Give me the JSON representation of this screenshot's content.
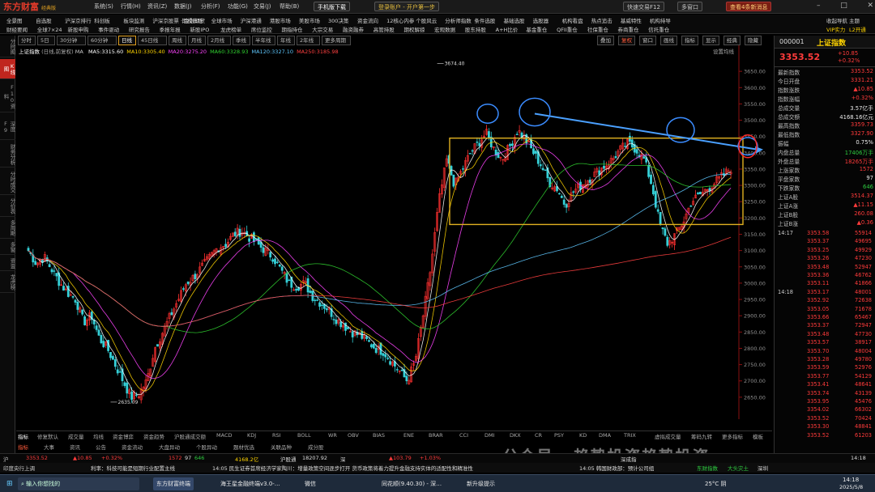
{
  "app": {
    "logo": "东方财富",
    "edition": "经典版",
    "menus": [
      "系统(S)",
      "行情(H)",
      "资讯(Z)",
      "数据(J)",
      "分析(F)",
      "功能(G)",
      "交易(J)",
      "帮助(B)"
    ],
    "phone_btn": "手机版下载",
    "login_btn": "登录账户 - 开户第一步",
    "search_btn": "快速交易F12",
    "multi_win": "多窗口",
    "notice_btn": "查看4条新消息",
    "window_controls": [
      "–",
      "□",
      "✕"
    ]
  },
  "quick_rows": {
    "row1": [
      "全景图",
      "自选股",
      "沪深京排行",
      "科创板",
      "板块监测",
      "沪深京股票 · 金融期货",
      "期权市场",
      "全球市场",
      "沪深港通",
      "港股市场",
      "美股市场",
      "300决策",
      "资金流向",
      "12核心内参",
      "个股风云",
      "分析师指数",
      "条件选股",
      "基础选股",
      "选股器",
      "机构看盘",
      "热点追击",
      "基威特性",
      "机构持导"
    ],
    "row2": [
      "财经要闻",
      "全球7×24",
      "新股申购",
      "事件驱动",
      "研究报告",
      "季报年报",
      "新股IPO",
      "龙虎榜单",
      "席位监控",
      "期指持仓",
      "大宗交易",
      "融资融券",
      "高管持股",
      "期权解掠",
      "宏观数据",
      "股东持股",
      "A+H比价",
      "基金重仓",
      "QFII重仓",
      "社保重仓",
      "券商重仓",
      "信托重仓"
    ],
    "right1": [
      "收起导航",
      "主题"
    ],
    "right2": [
      "VIP实力",
      "L2开通"
    ]
  },
  "period_bar": {
    "items": [
      "分时",
      "5日",
      "30分钟",
      "60分钟",
      "日线",
      "45日线",
      "周线",
      "月线",
      "2月线",
      "季线",
      "半年线",
      "年线",
      "2年线",
      "更多周期"
    ],
    "active": "日线",
    "right_items": [
      "叠加",
      "复权",
      "窗口",
      "画线",
      "指标",
      "显示",
      "经典",
      "隐藏"
    ]
  },
  "left_nav": [
    "分时图",
    "K线图",
    "F10资料",
    "深度F9",
    "财务分析",
    "分时成交",
    "分价表",
    "多周期",
    "多窗",
    "资金",
    "龙虎榜"
  ],
  "left_nav_active": "K线图",
  "chart": {
    "title": "上证指数",
    "subtitle": "(日线,前复权)",
    "ma_label": "MA",
    "ma": [
      {
        "name": "MA5",
        "value": "3315.60",
        "color": "#ffffff"
      },
      {
        "name": "MA10",
        "value": "3305.40",
        "color": "#ffd400"
      },
      {
        "name": "MA20",
        "value": "3275.20",
        "color": "#ff44ff"
      },
      {
        "name": "MA60",
        "value": "3328.93",
        "color": "#30d030"
      },
      {
        "name": "MA120",
        "value": "3327.10",
        "color": "#5fc8ff"
      },
      {
        "name": "MA250",
        "value": "3185.98",
        "color": "#ff4040"
      }
    ],
    "settings_label": "设置均线",
    "high_label": "3674.40",
    "low_label": "2635.09",
    "price_axis": [
      "3650.00",
      "3600.00",
      "3550.00",
      "3500.00",
      "3450.00",
      "3400.00",
      "3350.00",
      "3300.00",
      "3250.00",
      "3200.00",
      "3150.00",
      "3100.00",
      "3050.00",
      "3000.00",
      "2950.00",
      "2900.00",
      "2850.00",
      "2800.00",
      "2750.00",
      "2700.00",
      "2650.00"
    ],
    "price_range": [
      2600,
      3700
    ],
    "box_range": [
      3180,
      3445
    ],
    "trend_from": 3520,
    "trend_to": 3410
  },
  "chart_data": {
    "type": "candlestick",
    "title": "上证指数",
    "series_close_sketch": [
      3100,
      3060,
      3080,
      3040,
      3000,
      2970,
      2950,
      2880,
      2900,
      2830,
      2800,
      2750,
      2700,
      2650,
      2660,
      2700,
      2800,
      2850,
      2900,
      2950,
      3000,
      3020,
      3050,
      3080,
      3110,
      3120,
      3150,
      3160,
      3140,
      3120,
      3100,
      3080,
      3040,
      3000,
      2990,
      3000,
      2960,
      2940,
      2920,
      2890,
      2870,
      2850,
      2840,
      2820,
      2800,
      2790,
      2760,
      2730,
      2700,
      2760,
      2900,
      3050,
      3250,
      3380,
      3300,
      3350,
      3400,
      3430,
      3460,
      3410,
      3380,
      3420,
      3470,
      3440,
      3400,
      3360,
      3310,
      3290,
      3240,
      3280,
      3300,
      3320,
      3340,
      3360,
      3380,
      3410,
      3430,
      3410,
      3380,
      3300,
      3180,
      3120,
      3150,
      3190,
      3250,
      3270,
      3290,
      3310,
      3330,
      3353
    ]
  },
  "indicator_tabs": [
    "指标",
    "修复默认",
    "成交量",
    "均线",
    "资金博弈",
    "资金趋势",
    "沪股通成交额",
    "MACD",
    "KDJ",
    "RSI",
    "BOLL",
    "WR",
    "OBV",
    "BIAS",
    "ENE",
    "BRAR",
    "CCI",
    "DMI",
    "DKX",
    "CR",
    "PSY",
    "KD",
    "DMA",
    "TRIX",
    "虚拟成交量",
    "筹码九转",
    "更多指标",
    "模板"
  ],
  "bottom_tabs": [
    "指标",
    "大事",
    "资讯",
    "公告",
    "资金流动",
    "大盘异动",
    "个股异动",
    "题材优选",
    "关联品种",
    "成分股"
  ],
  "ticker": {
    "label": "沪",
    "price": "3353.52",
    "change": "▲10.85",
    "pct": "+0.32%",
    "up": "1572",
    "flat": "97",
    "down": "646",
    "amount": "4168.2亿",
    "sh_label": "沪股通",
    "shv": "18207.92",
    "sz_label": "深",
    "szc": "▲103.79",
    "szp": "+1.03%",
    "cy": "深成指",
    "time": "14:18"
  },
  "news": {
    "left": "印度央行上调",
    "items": [
      "利率：科技可能是短期行业配置主线",
      "14:05 民生证券首席经济学家陶川：增量政策空间逐步打开 货币政策将着力提升金融支持实体的适配性和精准性",
      "14:05 韩国财政部：预计公司组"
    ],
    "right": [
      "东财指数",
      "大头灾土",
      "深圳"
    ]
  },
  "right_panel": {
    "code": "000001",
    "name": "上证指数",
    "price": "3353.52",
    "change": "+10.85",
    "pct": "+0.32%",
    "fields": [
      {
        "k": "最新指数",
        "v": "3353.52",
        "c": "red"
      },
      {
        "k": "今日开盘",
        "v": "3331.21",
        "c": "red"
      },
      {
        "k": "指数涨跌",
        "v": "▲10.85",
        "c": "red"
      },
      {
        "k": "指数涨幅",
        "v": "+0.32%",
        "c": "red"
      },
      {
        "k": "总成交量",
        "v": "3.57亿手",
        "c": "white"
      },
      {
        "k": "总成交额",
        "v": "4168.16亿元",
        "c": "white"
      },
      {
        "k": "最高指数",
        "v": "3359.73",
        "c": "red"
      },
      {
        "k": "最低指数",
        "v": "3327.90",
        "c": "red"
      },
      {
        "k": "振幅",
        "v": "0.75%",
        "c": "white"
      },
      {
        "k": "内盘总量",
        "v": "17406万手",
        "c": "grn"
      },
      {
        "k": "外盘总量",
        "v": "18265万手",
        "c": "red"
      },
      {
        "k": "上涨家数",
        "v": "1572",
        "c": "red"
      },
      {
        "k": "平盘家数",
        "v": "97",
        "c": "white"
      },
      {
        "k": "下跌家数",
        "v": "646",
        "c": "grn"
      },
      {
        "k": "上证A股",
        "v": "3514.37",
        "c": "red"
      },
      {
        "k": "上证A涨",
        "v": "▲11.15",
        "c": "red"
      },
      {
        "k": "上证B股",
        "v": "260.08",
        "c": "red"
      },
      {
        "k": "上证B涨",
        "v": "▲0.36",
        "c": "red"
      }
    ],
    "ticks": [
      {
        "t": "14:17",
        "p": "3353.58",
        "v": "55914"
      },
      {
        "t": "",
        "p": "3353.37",
        "v": "49695"
      },
      {
        "t": "",
        "p": "3353.25",
        "v": "49929"
      },
      {
        "t": "",
        "p": "3353.26",
        "v": "47230"
      },
      {
        "t": "",
        "p": "3353.48",
        "v": "52947"
      },
      {
        "t": "",
        "p": "3353.36",
        "v": "46762"
      },
      {
        "t": "",
        "p": "3353.11",
        "v": "41866"
      },
      {
        "t": "14:18",
        "p": "3353.17",
        "v": "48001"
      },
      {
        "t": "",
        "p": "3352.92",
        "v": "72638"
      },
      {
        "t": "",
        "p": "3353.05",
        "v": "71678"
      },
      {
        "t": "",
        "p": "3353.66",
        "v": "65467"
      },
      {
        "t": "",
        "p": "3353.37",
        "v": "72947"
      },
      {
        "t": "",
        "p": "3353.48",
        "v": "47730"
      },
      {
        "t": "",
        "p": "3353.57",
        "v": "38917"
      },
      {
        "t": "",
        "p": "3353.70",
        "v": "48004"
      },
      {
        "t": "",
        "p": "3353.28",
        "v": "49780"
      },
      {
        "t": "",
        "p": "3353.59",
        "v": "52976"
      },
      {
        "t": "",
        "p": "3353.77",
        "v": "54129"
      },
      {
        "t": "",
        "p": "3353.41",
        "v": "48641"
      },
      {
        "t": "",
        "p": "3353.74",
        "v": "43139"
      },
      {
        "t": "",
        "p": "3353.95",
        "v": "45476"
      },
      {
        "t": "",
        "p": "3354.02",
        "v": "66302"
      },
      {
        "t": "",
        "p": "3353.52",
        "v": "70424"
      },
      {
        "t": "",
        "p": "3353.30",
        "v": "48841"
      },
      {
        "t": "",
        "p": "3353.52",
        "v": "61203"
      }
    ]
  },
  "watermark": "公众号 · 趋势投资趋势投资",
  "taskbar": {
    "search": "输入你想找的",
    "apps": [
      "东方财富终端",
      "海王星金融终端v3.0-…",
      "微信",
      "同花顺(9.40.30) - 深…",
      "新升级提示"
    ],
    "weather": "25°C 阴",
    "time": "14:18",
    "date": "2025/5/8"
  }
}
